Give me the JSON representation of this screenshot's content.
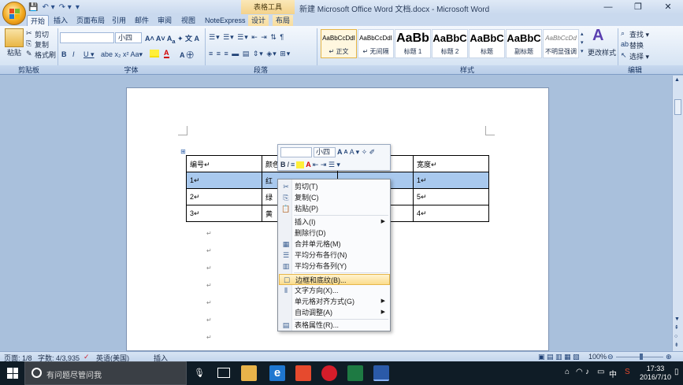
{
  "window": {
    "title": "新建 Microsoft Office Word 文档.docx - Microsoft Word",
    "context_group": "表格工具",
    "minimize": "—",
    "restore": "❐",
    "close": "✕"
  },
  "qat": {
    "save": "💾",
    "undo": "↶ ▾",
    "redo": "↷ ▾",
    "more": "▾"
  },
  "tabs": [
    "开始",
    "插入",
    "页面布局",
    "引用",
    "邮件",
    "审阅",
    "视图",
    "NoteExpress",
    "设计",
    "布局"
  ],
  "ribbon": {
    "clipboard": {
      "paste": "粘贴",
      "cut": "剪切",
      "copy": "复制",
      "format_painter": "格式刷",
      "label": "剪贴板"
    },
    "font": {
      "font_name": "",
      "font_size": "小四",
      "label": "字体"
    },
    "paragraph": {
      "label": "段落"
    },
    "styles": {
      "label": "样式",
      "items": [
        {
          "sample": "AaBbCcDdI",
          "name": "↵ 正文"
        },
        {
          "sample": "AaBbCcDdI",
          "name": "↵ 无间隔"
        },
        {
          "sample": "AaBb",
          "name": "标题 1"
        },
        {
          "sample": "AaBbC",
          "name": "标题 2"
        },
        {
          "sample": "AaBbC",
          "name": "标题"
        },
        {
          "sample": "AaBbC",
          "name": "副标题"
        },
        {
          "sample": "AaBbCcDd",
          "name": "不明显强调"
        }
      ],
      "change_styles": "更改样式"
    },
    "editing": {
      "find": "查找 ▾",
      "replace": "替换",
      "select": "选择 ▾",
      "label": "编辑"
    }
  },
  "table": {
    "rows": [
      [
        "编号↵",
        "颜色",
        "",
        "宽度↵"
      ],
      [
        "1↵",
        "红",
        "",
        "1↵"
      ],
      [
        "2↵",
        "绿",
        "",
        "5↵"
      ],
      [
        "3↵",
        "黄",
        "",
        "4↵"
      ]
    ],
    "selected_row": 1
  },
  "mini_toolbar": {
    "font_size": "小四",
    "grow": "A",
    "shrink": "A",
    "bold": "B",
    "italic": "I"
  },
  "context_menu": [
    {
      "label": "剪切(T)",
      "icon": "✂"
    },
    {
      "label": "复制(C)",
      "icon": "⎘"
    },
    {
      "label": "粘贴(P)",
      "icon": "📋"
    },
    {
      "separator": true
    },
    {
      "label": "插入(I)",
      "submenu": true
    },
    {
      "label": "删除行(D)"
    },
    {
      "label": "合并单元格(M)",
      "icon": "▦"
    },
    {
      "label": "平均分布各行(N)",
      "icon": "☰"
    },
    {
      "label": "平均分布各列(Y)",
      "icon": "▥"
    },
    {
      "separator": true
    },
    {
      "label": "边框和底纹(B)...",
      "icon": "☐",
      "highlighted": true
    },
    {
      "label": "文字方向(X)...",
      "icon": "⫴"
    },
    {
      "label": "单元格对齐方式(G)",
      "submenu": true
    },
    {
      "label": "自动调整(A)",
      "submenu": true
    },
    {
      "separator": true
    },
    {
      "label": "表格属性(R)...",
      "icon": "▤"
    }
  ],
  "status": {
    "page": "页面: 1/8",
    "words": "字数: 4/3,935",
    "language": "英语(美国)",
    "mode": "插入",
    "zoom": "100%"
  },
  "taskbar": {
    "search_placeholder": "有问题尽管问我",
    "time": "17:33",
    "date": "2016/7/10",
    "ime": "中"
  }
}
